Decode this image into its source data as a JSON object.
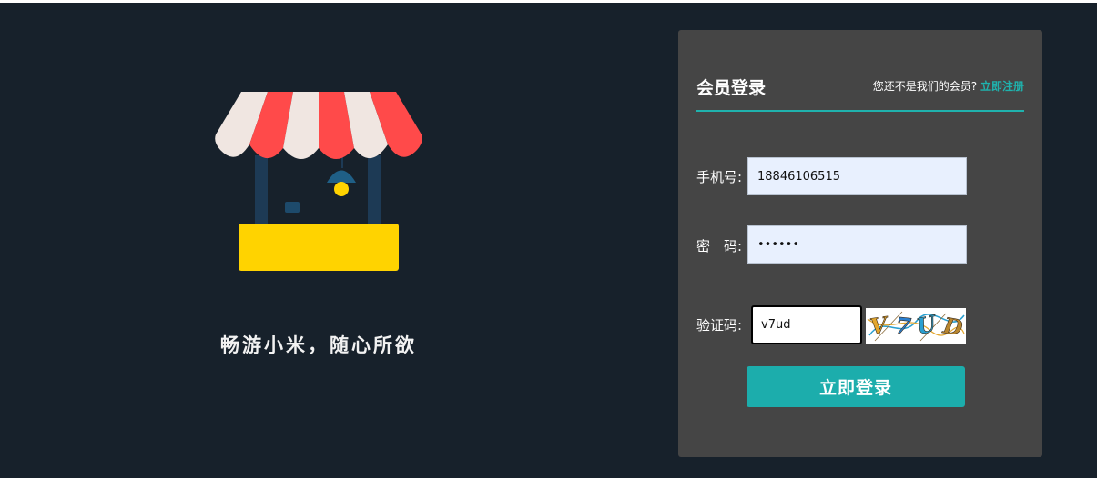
{
  "brand": {
    "slogan": "畅游小米，随心所欲",
    "colors": {
      "awning_red": "#ff4a4a",
      "awning_white": "#f0e6e1",
      "post": "#1d3a55",
      "counter": "#ffd300",
      "bulb": "#ffd300"
    }
  },
  "login": {
    "title": "会员登录",
    "register_prompt": "您还不是我们的会员?",
    "register_link": "立即注册",
    "phone": {
      "label": "手机号:",
      "value": "18846106515"
    },
    "password": {
      "label": "密　码:",
      "value": "123456"
    },
    "captcha": {
      "label": "验证码:",
      "value": "v7ud",
      "image_text": "V7UD"
    },
    "submit_label": "立即登录",
    "colors": {
      "accent": "#1fb2ad",
      "panel": "#454545",
      "background": "#17212b"
    }
  }
}
